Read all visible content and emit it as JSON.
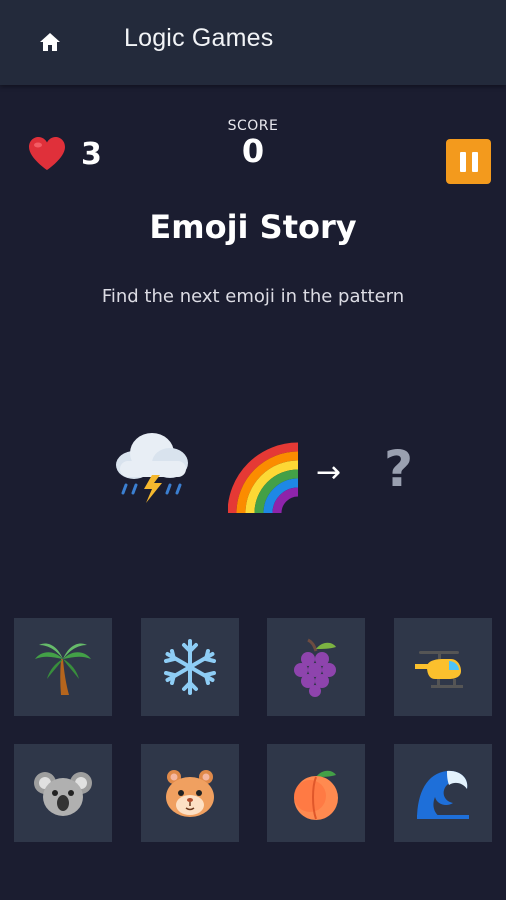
{
  "appbar": {
    "title": "Logic Games",
    "home_icon": "home-icon"
  },
  "status": {
    "lives": "3",
    "score_label": "SCORE",
    "score": "0"
  },
  "game": {
    "title": "Emoji Story",
    "instructions": "Find the next emoji in the pattern",
    "sequence": [
      "cloud-lightning-rain-icon",
      "rainbow-icon"
    ],
    "arrow": "→",
    "question": "?"
  },
  "options": [
    {
      "emoji": "palm-tree-icon"
    },
    {
      "emoji": "snowflake-icon"
    },
    {
      "emoji": "grapes-icon"
    },
    {
      "emoji": "helicopter-icon"
    },
    {
      "emoji": "koala-icon"
    },
    {
      "emoji": "hamster-icon"
    },
    {
      "emoji": "peach-icon"
    },
    {
      "emoji": "wave-icon"
    }
  ],
  "colors": {
    "background": "#1b1d30",
    "appbar": "#232a3b",
    "tile": "#2f3749",
    "pause": "#f39a1d"
  }
}
